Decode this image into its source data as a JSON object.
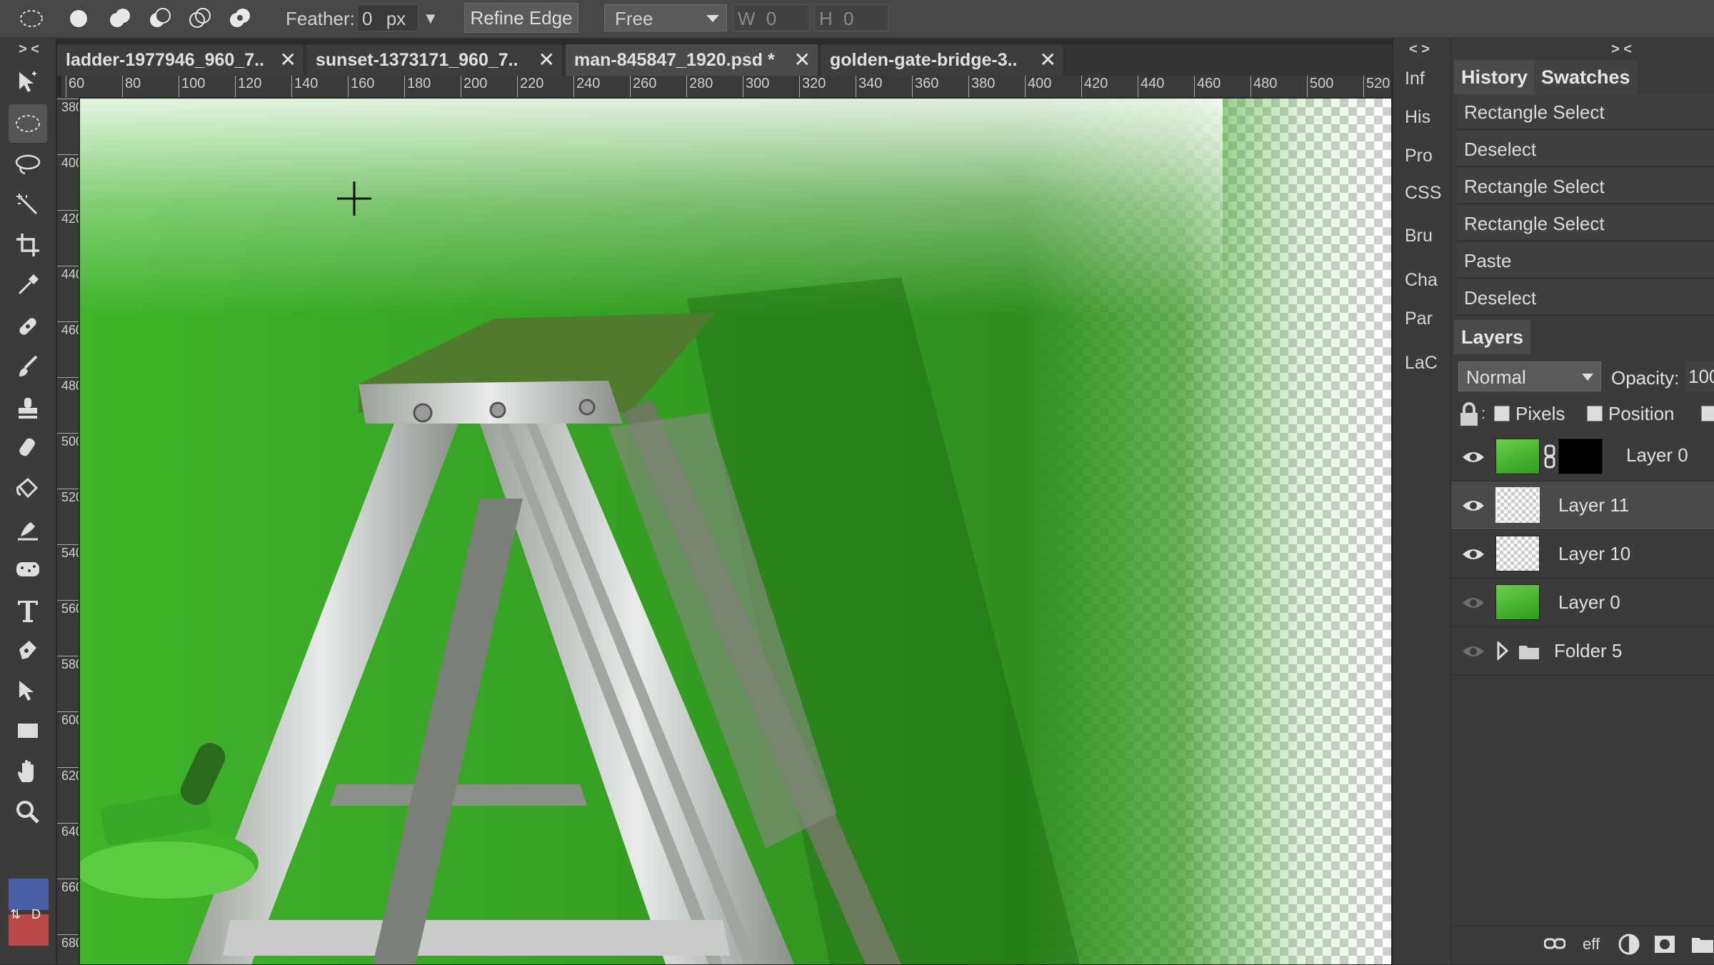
{
  "options_bar": {
    "feather_label": "Feather:",
    "feather_value": "0",
    "feather_unit": "px",
    "dropdown_arrow": "▼",
    "refine_edge_label": "Refine Edge",
    "style_select_value": "Free",
    "width_label": "W",
    "width_value": "0",
    "height_label": "H",
    "height_value": "0"
  },
  "collapse_left": "> <",
  "collapse_mini": "< >",
  "collapse_right": "> <",
  "tabs": [
    {
      "label": "ladder-1977946_960_7..",
      "close": "✕"
    },
    {
      "label": "sunset-1373171_960_7..",
      "close": "✕"
    },
    {
      "label": "man-845847_1920.psd *",
      "close": "✕"
    },
    {
      "label": "golden-gate-bridge-3..",
      "close": "✕"
    }
  ],
  "ruler_h": [
    "60",
    "80",
    "100",
    "120",
    "140",
    "160",
    "180",
    "200",
    "220",
    "240",
    "260",
    "280",
    "300",
    "320",
    "340",
    "360",
    "380",
    "400",
    "420",
    "440",
    "460",
    "480",
    "500",
    "520"
  ],
  "ruler_v": [
    "380",
    "400",
    "420",
    "440",
    "460",
    "480",
    "500",
    "520",
    "540",
    "560",
    "580",
    "600",
    "620",
    "640",
    "660",
    "680"
  ],
  "mini_panels": [
    "Inf",
    "His",
    "Pro",
    "CSS",
    "Bru",
    "Cha",
    "Par",
    "LaC"
  ],
  "panel_tabs": {
    "history": "History",
    "swatches": "Swatches"
  },
  "history": [
    "Rectangle Select",
    "Deselect",
    "Rectangle Select",
    "Rectangle Select",
    "Paste",
    "Deselect"
  ],
  "layers_panel": {
    "title": "Layers",
    "blend_mode": "Normal",
    "opacity_label": "Opacity:",
    "opacity_value": "100",
    "lock_pixels": "Pixels",
    "lock_position": "Position"
  },
  "layers": [
    {
      "name": "Layer 0",
      "visible": true
    },
    {
      "name": "Layer 11",
      "visible": true
    },
    {
      "name": "Layer 10",
      "visible": true
    },
    {
      "name": "Layer 0",
      "visible": false
    },
    {
      "name": "Folder 5",
      "visible": false
    }
  ],
  "footer": {
    "effects": "eff"
  },
  "tool_color_labels": {
    "swap": "⇅",
    "default": "D"
  },
  "colors": {
    "foreground": "#4a5fa8",
    "background": "#b94848",
    "green": "#3fb52a"
  }
}
